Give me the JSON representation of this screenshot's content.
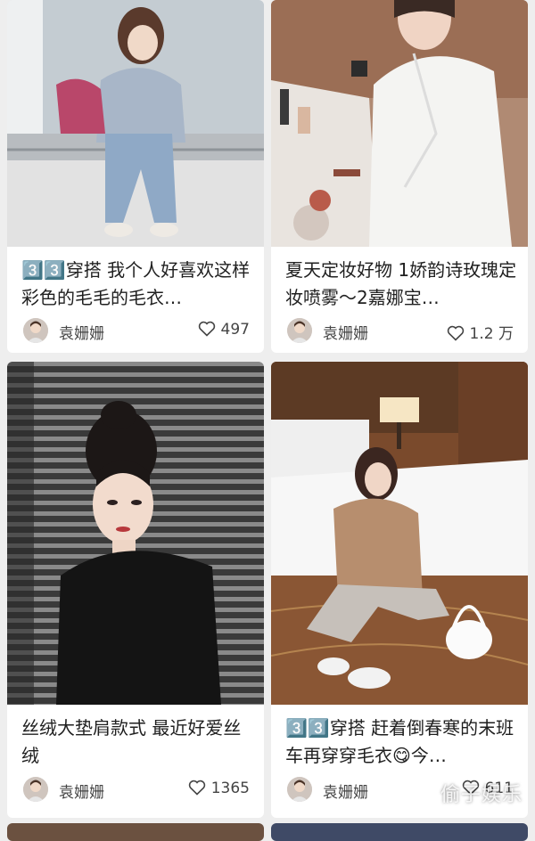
{
  "cards": [
    {
      "title_prefix": "3️⃣3️⃣",
      "title": "穿搭 我个人好喜欢这样彩色的毛毛的毛衣…",
      "author": "袁姗姗",
      "likes": "497"
    },
    {
      "title_prefix": "",
      "title": "夏天定妆好物 1娇韵诗玫瑰定妆喷雾～2嘉娜宝…",
      "author": "袁姗姗",
      "likes": "1.2 万"
    },
    {
      "title_prefix": "",
      "title": "丝绒大垫肩款式 最近好爱丝绒",
      "author": "袁姗姗",
      "likes": "1365"
    },
    {
      "title_prefix": "3️⃣3️⃣",
      "title": "穿搭 赶着倒春寒的末班车再穿穿毛衣😋今…",
      "author": "袁姗姗",
      "likes": "611"
    }
  ],
  "icons": {
    "like": "heart-outline-icon",
    "avatar": "author-avatar"
  },
  "watermark": "偷子娱乐"
}
